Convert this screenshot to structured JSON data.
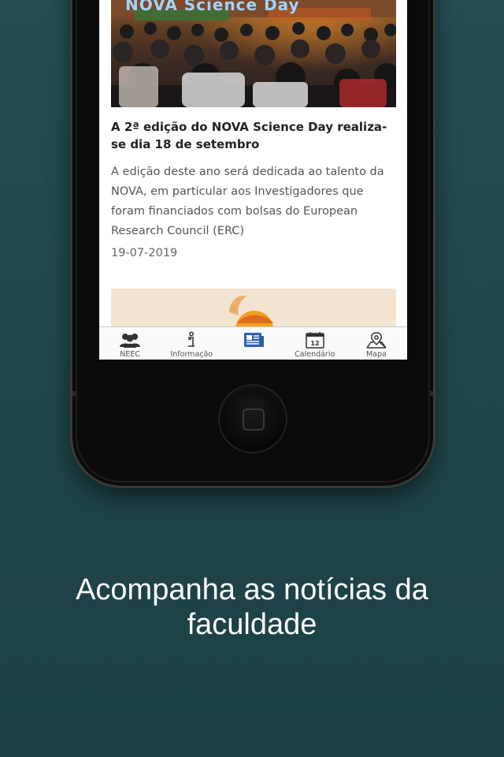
{
  "article": {
    "hero_banner_text": "NOVA Science Day",
    "title": "A 2ª edição do NOVA Science Day realiza-se dia 18 de setembro",
    "summary": "A edição deste ano será dedicada ao talento da NOVA, em particular aos Investigadores que foram financiados com bolsas do European Research Council (ERC)",
    "date": "19-07-2019"
  },
  "tabbar": {
    "tabs": [
      {
        "label": "NEEC",
        "icon": "group-icon",
        "active": false
      },
      {
        "label": "Informação",
        "icon": "info-icon",
        "active": false
      },
      {
        "label": "",
        "icon": "news-icon",
        "active": true
      },
      {
        "label": "Calendário",
        "icon": "calendar-icon",
        "active": false,
        "icon_text": "12"
      },
      {
        "label": "Mapa",
        "icon": "map-pin-icon",
        "active": false
      }
    ]
  },
  "caption": {
    "line1": "Acompanha as notícias da",
    "line2": "faculdade"
  },
  "colors": {
    "background": "#1f4549",
    "active_tab": "#2f5fb0",
    "tab_icon": "#333333"
  }
}
